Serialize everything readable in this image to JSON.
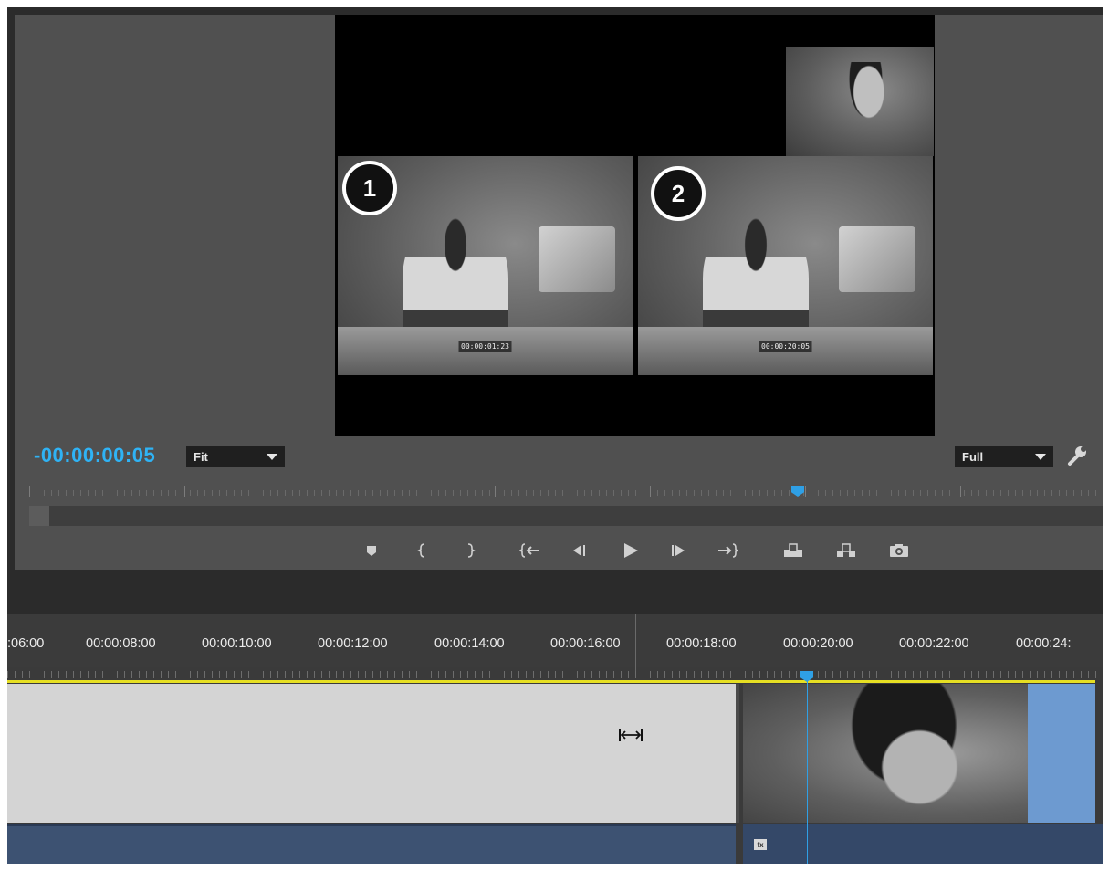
{
  "monitor": {
    "timecode": "-00:00:00:05",
    "zoom_dropdown": {
      "selected": "Fit"
    },
    "quality_dropdown": {
      "selected": "Full"
    },
    "frames": [
      {
        "badge": "1",
        "timecode": "00:00:01:23"
      },
      {
        "badge": "2",
        "timecode": "00:00:20:05"
      }
    ],
    "transport_icons": [
      "add-marker-icon",
      "mark-in-icon",
      "mark-out-icon",
      "go-to-in-icon",
      "step-back-icon",
      "play-icon",
      "step-forward-icon",
      "go-to-out-icon",
      "lift-icon",
      "extract-icon",
      "export-frame-icon"
    ]
  },
  "timeline": {
    "ruler_labels": [
      ":06:00",
      "00:00:08:00",
      "00:00:10:00",
      "00:00:12:00",
      "00:00:14:00",
      "00:00:16:00",
      "00:00:18:00",
      "00:00:20:00",
      "00:00:22:00",
      "00:00:24:"
    ],
    "fx_label": "fx"
  },
  "colors": {
    "timecode_blue": "#2fb3f5",
    "playhead": "#2fa0e6",
    "work_area": "#e6df23",
    "audio_track": "#3d5272",
    "clip_blue": "#6d9ad0"
  }
}
